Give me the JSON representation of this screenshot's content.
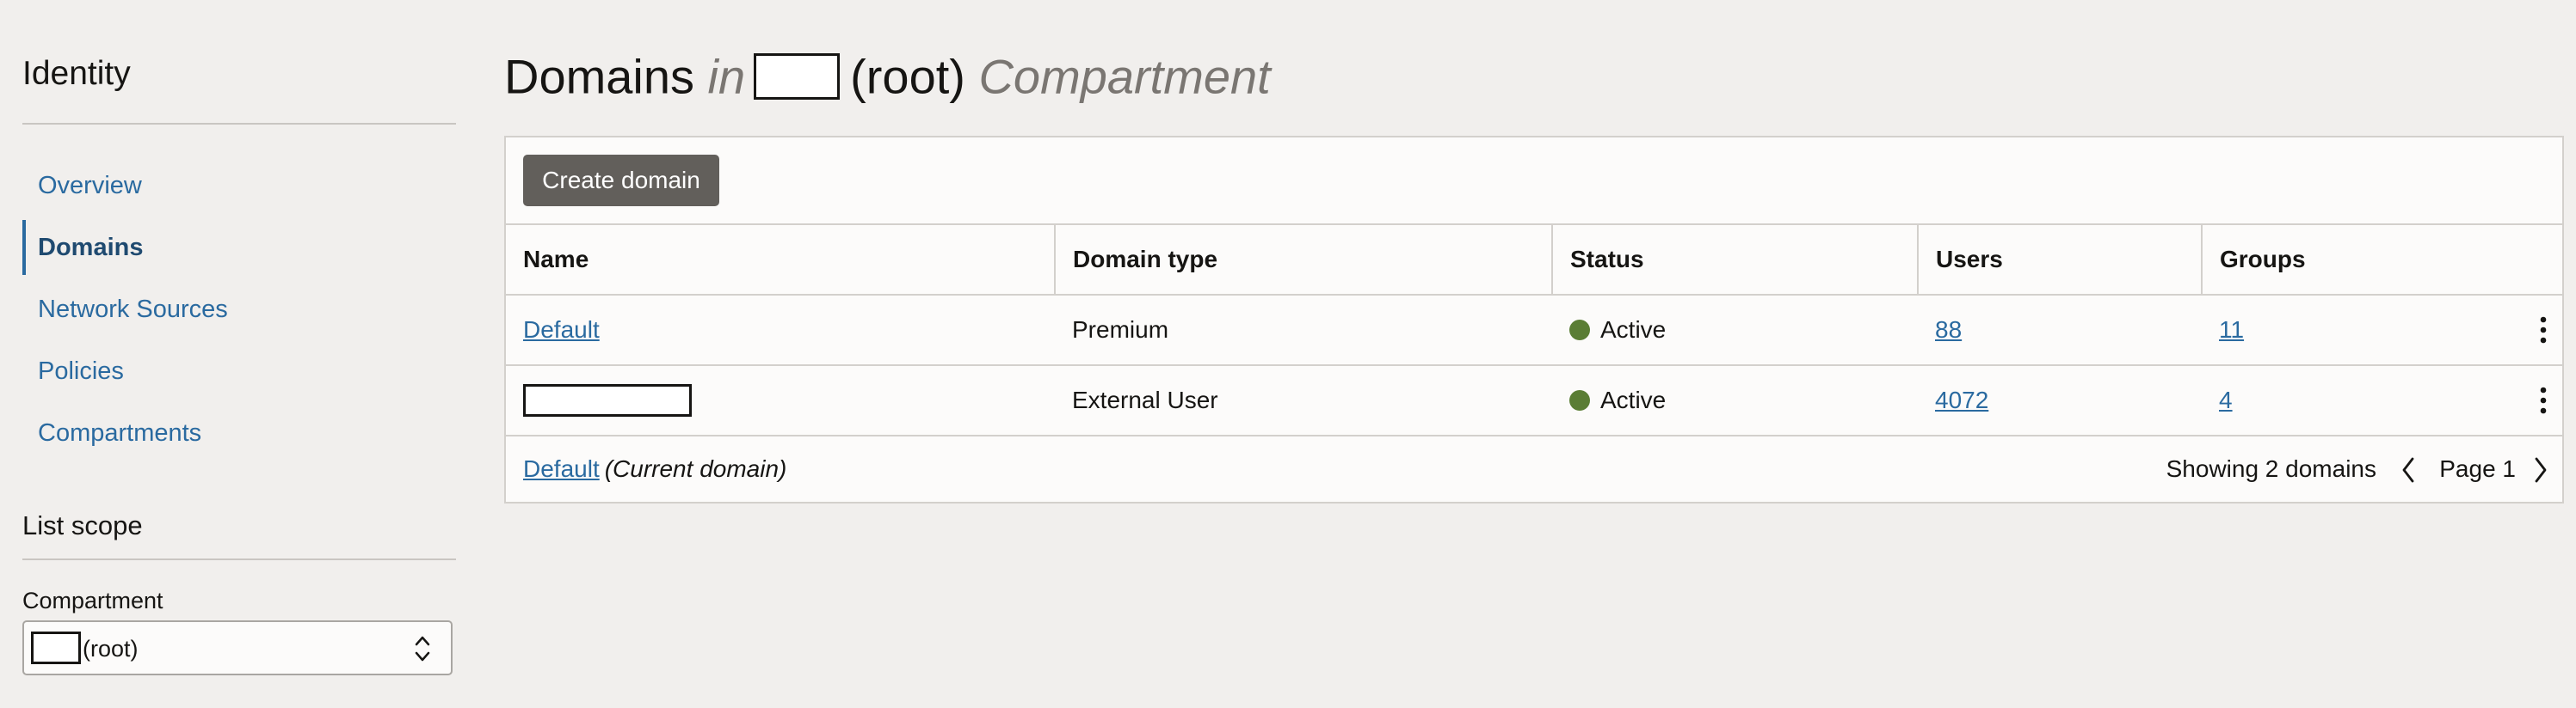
{
  "sidebar": {
    "title": "Identity",
    "items": [
      {
        "label": "Overview",
        "active": false
      },
      {
        "label": "Domains",
        "active": true
      },
      {
        "label": "Network Sources",
        "active": false
      },
      {
        "label": "Policies",
        "active": false
      },
      {
        "label": "Compartments",
        "active": false
      }
    ],
    "list_scope": {
      "title": "List scope",
      "compartment_label": "Compartment",
      "compartment_value": "(root)"
    }
  },
  "header": {
    "prefix": "Domains",
    "in_word": "in",
    "root": "(root)",
    "suffix": "Compartment"
  },
  "toolbar": {
    "create_label": "Create domain"
  },
  "table": {
    "columns": [
      "Name",
      "Domain type",
      "Status",
      "Users",
      "Groups"
    ],
    "rows": [
      {
        "name": "Default",
        "name_redacted": false,
        "domain_type": "Premium",
        "status": "Active",
        "users": "88",
        "groups": "11"
      },
      {
        "name": "",
        "name_redacted": true,
        "domain_type": "External User",
        "status": "Active",
        "users": "4072",
        "groups": "4"
      }
    ]
  },
  "footer": {
    "current_link": "Default",
    "current_note": "(Current domain)",
    "showing": "Showing 2 domains",
    "page": "Page 1"
  },
  "colors": {
    "link": "#2a6aa0",
    "status_active": "#5a7d34",
    "button": "#625f5b"
  }
}
